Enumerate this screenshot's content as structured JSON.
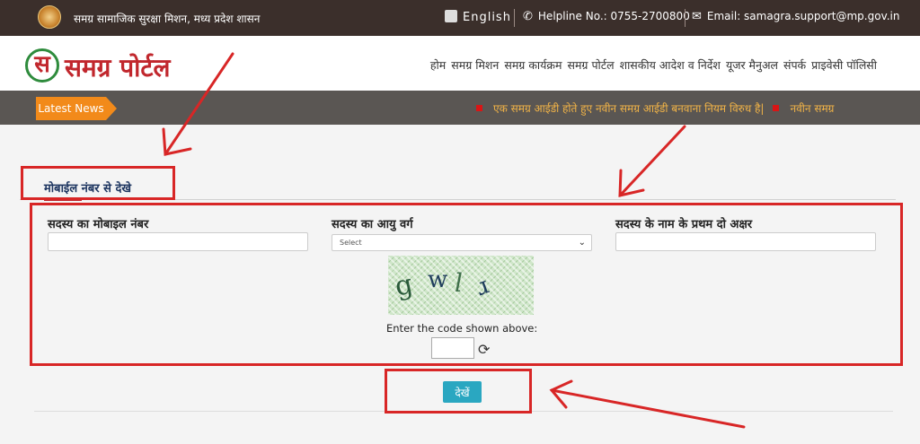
{
  "topbar": {
    "mission": "समग्र सामाजिक सुरक्षा मिशन, मध्य प्रदेश शासन",
    "language": "English",
    "helpline": "Helpline No.: 0755-2700800",
    "email": "Email: samagra.support@mp.gov.in"
  },
  "header": {
    "logo_mark": "स",
    "logo_text": "समग्र पोर्टल",
    "nav": [
      "होम",
      "समग्र मिशन",
      "समग्र कार्यक्रम",
      "समग्र पोर्टल",
      "शासकीय आदेश व निर्देश",
      "यूजर मैनुअल",
      "संपर्क",
      "प्राइवेसी पॉलिसी"
    ]
  },
  "news": {
    "label": "Latest News",
    "item1": "एक समग्र आईडी होते हुए नवीन समग्र आईडी बनवाना नियम विरुध है|",
    "item2": "नवीन समग्र"
  },
  "form": {
    "tab": "मोबाईल नंबर से देखे",
    "mobile_label": "सदस्य का मोबाइल नंबर",
    "age_label": "सदस्य का आयु वर्ग",
    "age_selected": "Select",
    "name_label": "सदस्य के नाम के प्रथम दो अक्षर",
    "captcha_chars": [
      "g",
      "w",
      "l",
      "r"
    ],
    "code_label": "Enter the code shown above:",
    "submit": "देखें"
  },
  "colors": {
    "topbar": "#3b2f2b",
    "newsbar": "#5a5653",
    "latest_badge": "#f28a1a",
    "ticker_text": "#f1b347",
    "brand_red": "#c1272d",
    "submit": "#2aa7c1",
    "annotation": "#d82626"
  }
}
